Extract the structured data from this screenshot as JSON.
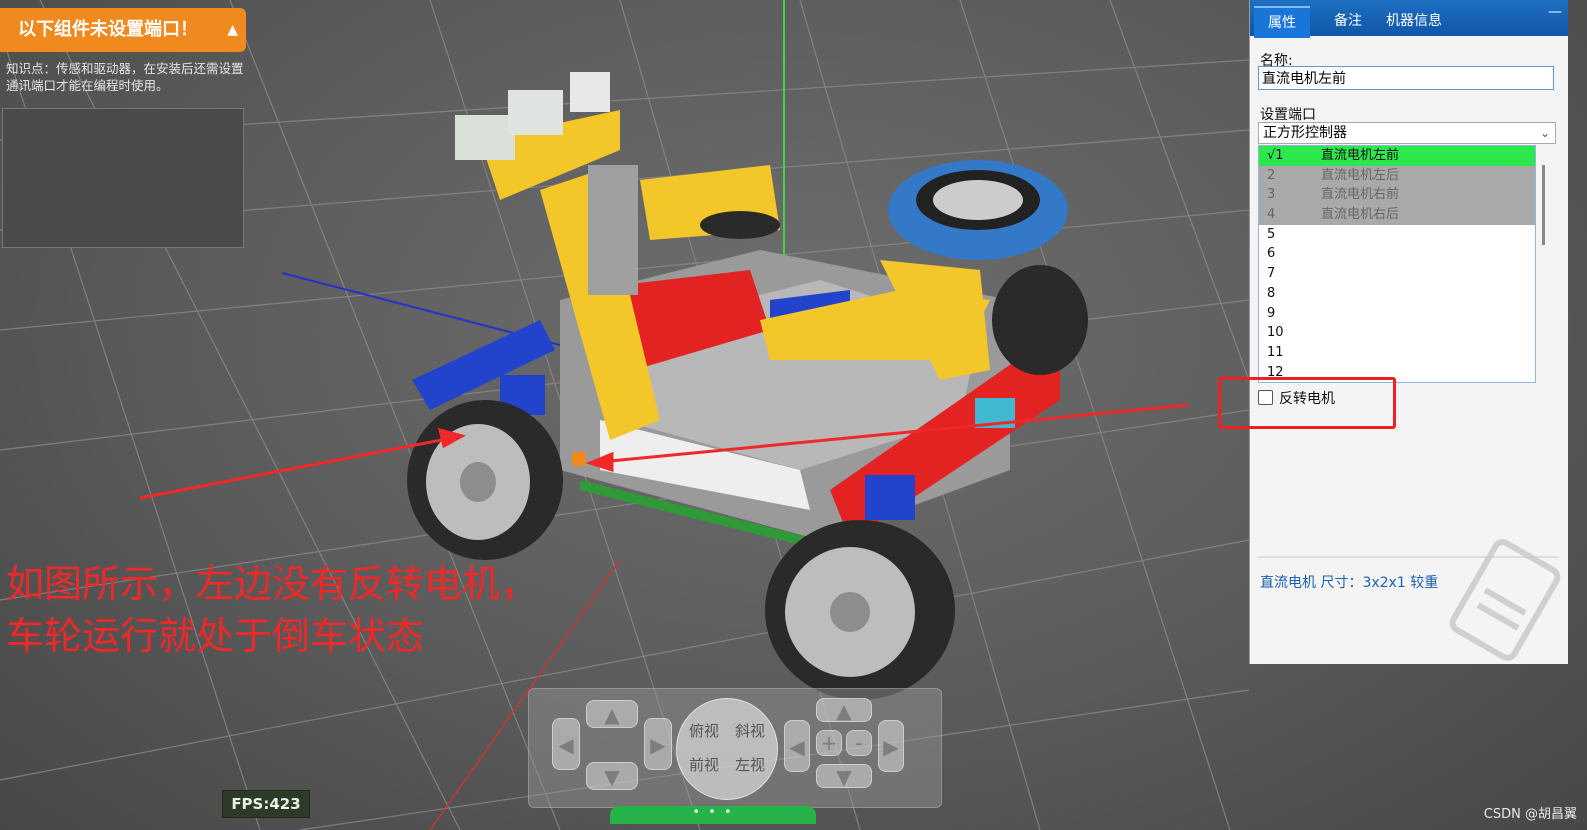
{
  "warning": {
    "title": "以下组件未设置端口！",
    "collapse_icon": "chevron-up-icon",
    "tip": "知识点：传感和驱动器，在安装后还需设置通讯端口才能在编程时使用。"
  },
  "panel": {
    "tabs": [
      "属性",
      "备注",
      "机器信息"
    ],
    "active_tab": "属性",
    "minimize": "—",
    "name_label": "名称:",
    "name_value": "直流电机左前",
    "port_label": "设置端口",
    "controller": "正方形控制器",
    "ports": [
      {
        "num": "√1",
        "device": "直流电机左前",
        "state": "selected"
      },
      {
        "num": "2",
        "device": "直流电机左后",
        "state": "used"
      },
      {
        "num": "3",
        "device": "直流电机右前",
        "state": "used"
      },
      {
        "num": "4",
        "device": "直流电机右后",
        "state": "used"
      },
      {
        "num": "5",
        "device": "",
        "state": "free"
      },
      {
        "num": "6",
        "device": "",
        "state": "free"
      },
      {
        "num": "7",
        "device": "",
        "state": "free"
      },
      {
        "num": "8",
        "device": "",
        "state": "free"
      },
      {
        "num": "9",
        "device": "",
        "state": "free"
      },
      {
        "num": "10",
        "device": "",
        "state": "free"
      },
      {
        "num": "11",
        "device": "",
        "state": "free"
      },
      {
        "num": "12",
        "device": "",
        "state": "free"
      }
    ],
    "reverse_label": "反转电机",
    "reverse_checked": false,
    "component_info": "直流电机 尺寸：3x2x1 较重"
  },
  "view_controls": {
    "top": "俯视",
    "oblique": "斜视",
    "front": "前视",
    "left": "左视",
    "zoom_in": "+",
    "zoom_out": "-"
  },
  "fps": "FPS:423",
  "bottom_handle": "• • •",
  "annotation": {
    "line1": "如图所示，左边没有反转电机，",
    "line2": "车轮运行就处于倒车状态"
  },
  "watermark": "CSDN @胡昌翼",
  "colors": {
    "warning_orange": "#f08a1e",
    "tab_blue": "#1565c0",
    "selected_green": "#2ee64e",
    "annotation_red": "#f02828"
  }
}
